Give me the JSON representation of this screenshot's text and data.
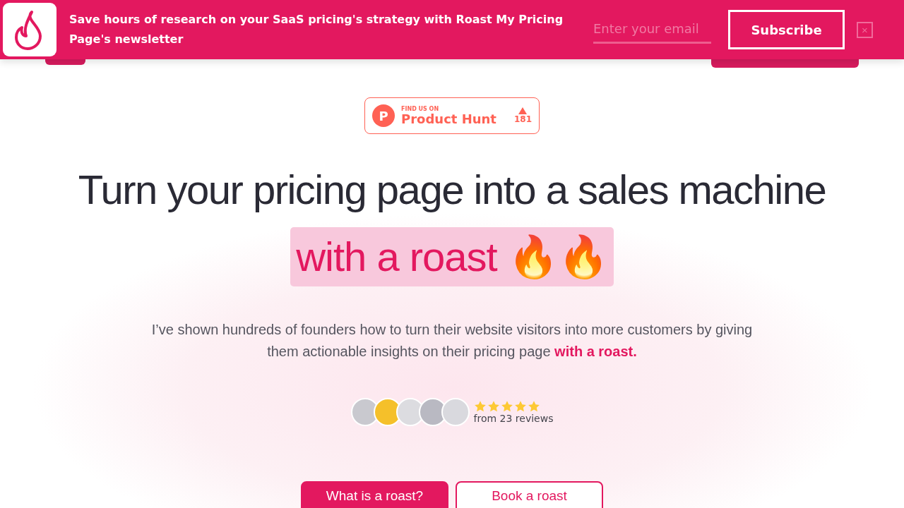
{
  "banner": {
    "message": "Save hours of research on your SaaS pricing's strategy with Roast My Pricing Page's newsletter",
    "email_placeholder": "Enter your email",
    "subscribe": "Subscribe",
    "close": "×"
  },
  "product_hunt": {
    "caption": "FIND US ON",
    "name": "Product Hunt",
    "letter": "P",
    "votes": "181"
  },
  "headline": {
    "line1": "Turn your pricing page into a sales machine",
    "highlight": "with a roast 🔥🔥"
  },
  "intro": "I’ve shown hundreds of founders how to turn their website visitors into more customers by giving them actionable insights on their pricing page **with a roast.**",
  "reviews": {
    "avatars": [
      {
        "color": "#c9c9cf"
      },
      {
        "color": "#f5c02a"
      },
      {
        "color": "#dcdce0"
      },
      {
        "color": "#b9b9c2"
      },
      {
        "color": "#d9d9de"
      }
    ],
    "stars": 5,
    "caption": "from 23 reviews"
  },
  "buttons": [
    {
      "label": "What is a roast?",
      "kind": "primary"
    },
    {
      "label": "Book a roast",
      "kind": "secondary"
    }
  ]
}
